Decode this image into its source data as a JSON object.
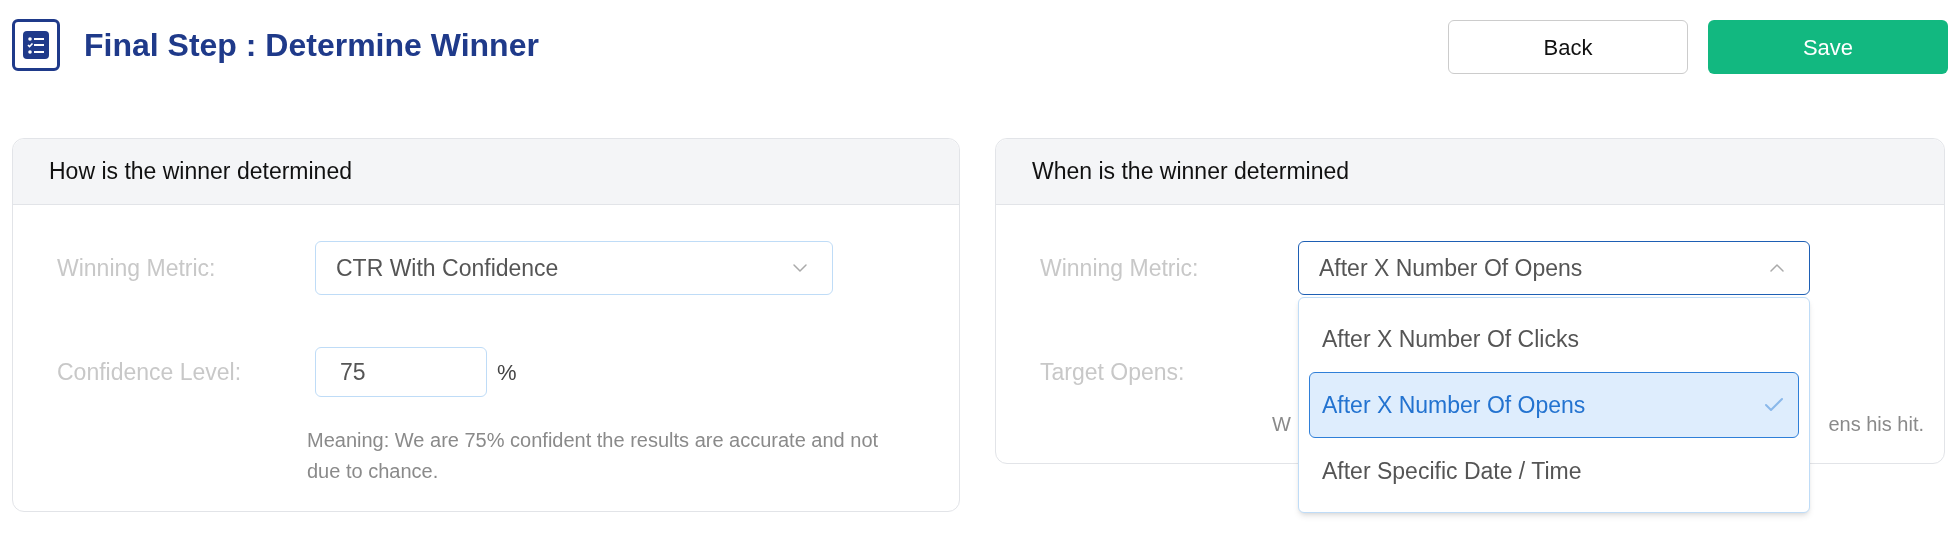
{
  "header": {
    "title": "Final Step : Determine Winner"
  },
  "buttons": [
    {
      "label": "Back",
      "kind": "secondary"
    },
    {
      "label": "Save",
      "kind": "primary"
    }
  ],
  "how_card": {
    "title": "How is the winner determined",
    "winning_metric": {
      "label": "Winning Metric:",
      "value": "CTR With Confidence",
      "expanded": false
    },
    "confidence_level": {
      "label": "Confidence Level:",
      "value": "75",
      "unit": "%"
    },
    "hint": "Meaning: We are 75% confident the results are accurate and not due to chance."
  },
  "when_card": {
    "title": "When is the winner determined",
    "winning_metric": {
      "label": "Winning Metric:",
      "value": "After X Number Of Opens",
      "expanded": true,
      "options": [
        {
          "label": "After X Number Of Clicks",
          "selected": false
        },
        {
          "label": "After X Number Of Opens",
          "selected": true
        },
        {
          "label": "After Specific Date / Time",
          "selected": false
        }
      ]
    },
    "target_opens": {
      "label": "Target Opens:"
    },
    "hint_fragments": [
      "W",
      "ens his hit."
    ]
  }
}
